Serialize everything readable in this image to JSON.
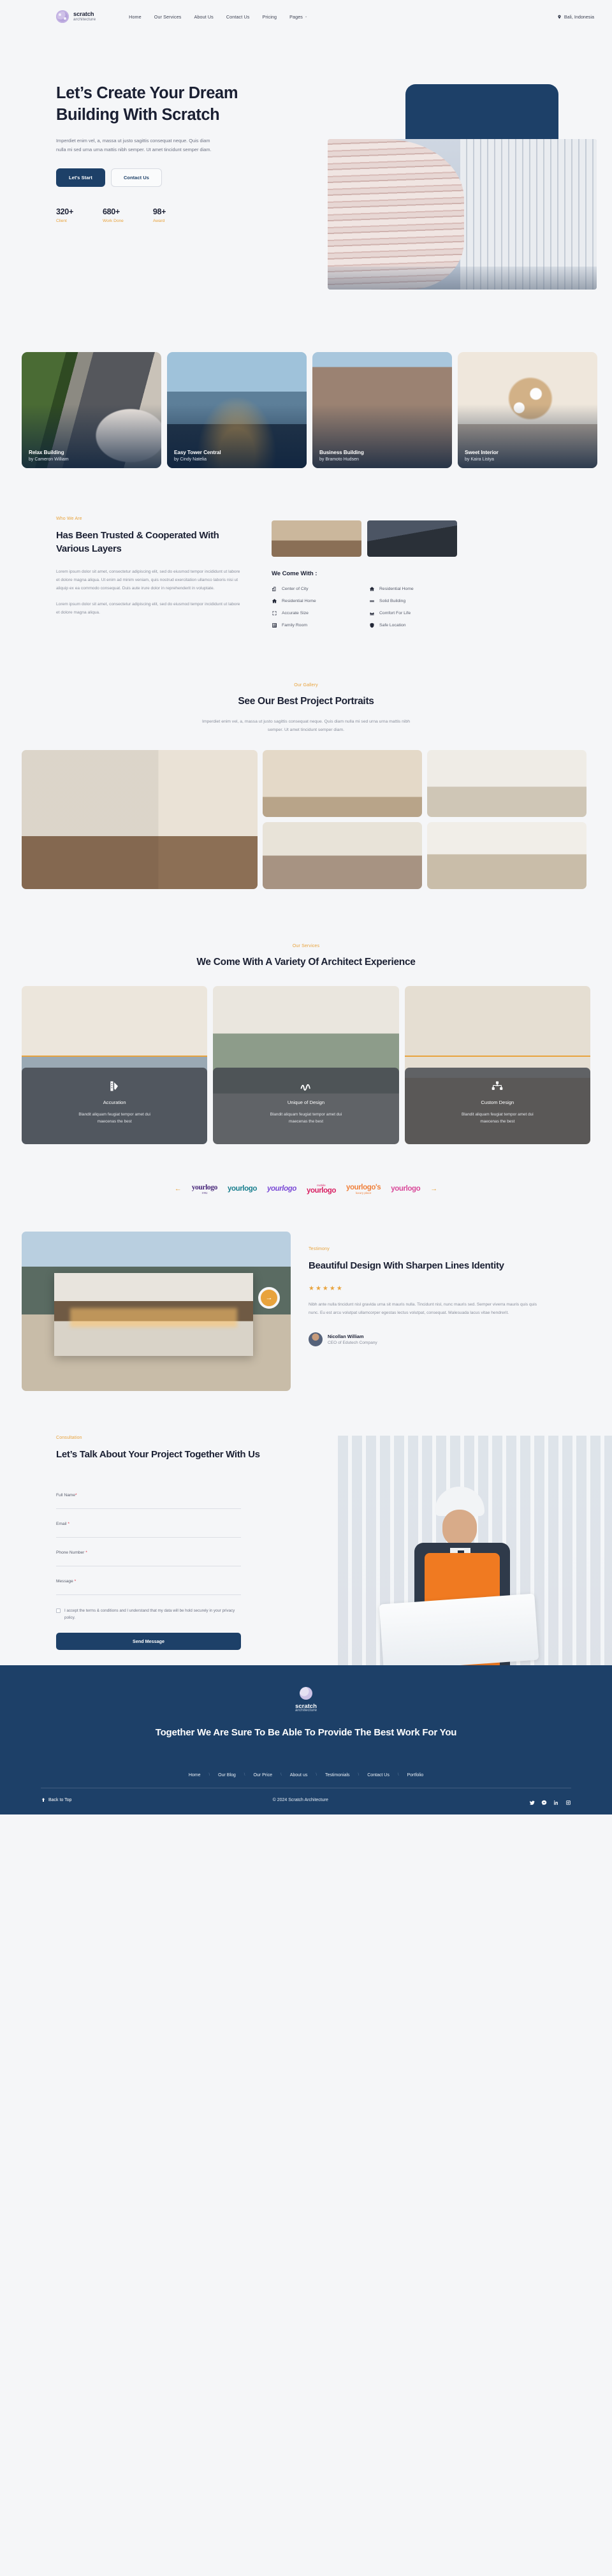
{
  "brand": {
    "name": "scratch",
    "sub": "architecture",
    "logo_icon": "flower-cluster-icon"
  },
  "header": {
    "nav": [
      {
        "label": "Home"
      },
      {
        "label": "Our Services"
      },
      {
        "label": "About Us"
      },
      {
        "label": "Contact Us"
      },
      {
        "label": "Pricing"
      },
      {
        "label": "Pages",
        "caret": "⌄"
      }
    ],
    "location": "Bali, Indonesia",
    "location_icon": "map-pin-icon"
  },
  "hero": {
    "title": "Let’s Create Your Dream Building With Scratch",
    "paragraph": "Imperdiet enim vel, a, massa ut justo sagittis consequat neque. Quis diam nulla mi sed urna urna mattis nibh semper. Ut amet tincidunt semper diam.",
    "primary_btn": "Let's Start",
    "secondary_btn": "Contact Us",
    "stats": [
      {
        "value": "320+",
        "label": "Client"
      },
      {
        "value": "680+",
        "label": "Work Done"
      },
      {
        "value": "98+",
        "label": "Award"
      }
    ]
  },
  "projects": [
    {
      "title": "Relax Building",
      "author": "by Cameron William"
    },
    {
      "title": "Easy Tower Central",
      "author": "by Cindy Natelia"
    },
    {
      "title": "Business Building",
      "author": "by Bramoto Hudsen"
    },
    {
      "title": "Sweet Interior",
      "author": "by Kaira Listya"
    }
  ],
  "who": {
    "eyebrow": "Who We Are",
    "title": "Has Been Trusted & Cooperated With Various Layers",
    "paragraph1": "Lorem ipsum dolor sit amet, consectetur adipiscing elit, sed do eiusmod tempor incididunt ut labore et dolore magna aliqua. Ut enim ad minim veniam, quis nostrud exercitation ullamco laboris nisi ut aliquip ex ea commodo consequat. Duis aute irure dolor in reprehenderit in voluptate.",
    "paragraph2": "Lorem ipsum dolor sit amet, consectetur adipiscing elit, sed do eiusmod tempor incididunt ut labore et dolore magna aliqua.",
    "features_title": "We Come With :",
    "features": [
      {
        "label": "Center of City",
        "icon": "city-buildings-icon"
      },
      {
        "label": "Residential Home",
        "icon": "home-icon"
      },
      {
        "label": "Residential Home",
        "icon": "home-icon"
      },
      {
        "label": "Solid Building",
        "icon": "layers-lines-icon"
      },
      {
        "label": "Accurate Size",
        "icon": "crop-frame-icon"
      },
      {
        "label": "Comfort For Life",
        "icon": "sofa-icon"
      },
      {
        "label": "Family Room",
        "icon": "grid-window-icon"
      },
      {
        "label": "Safe Location",
        "icon": "shield-icon"
      }
    ]
  },
  "gallery": {
    "eyebrow": "Our Gallery",
    "title": "See Our Best Project Portraits",
    "sub": "Imperdiet enim vel, a, massa ut justo sagittis consequat neque. Quis diam nulla mi sed urna urna mattis nibh semper. Ut amet tincidunt semper diam."
  },
  "services": {
    "eyebrow": "Our Services",
    "title": "We Come With A Variety Of Architect Experience",
    "cards": [
      {
        "title": "Accuration",
        "desc": "Blandit aliquam feugiat tempor amet dui maecenas the best",
        "icon": "color-swatch-icon"
      },
      {
        "title": "Unique of Design",
        "desc": "Blandit aliquam feugiat tempor amet dui maecenas the best",
        "icon": "signature-scribble-icon"
      },
      {
        "title": "Custom Design",
        "desc": "Blandit aliquam feugiat tempor amet dui maecenas the best",
        "icon": "nodes-connect-icon"
      }
    ]
  },
  "logos": {
    "prev_icon": "arrow-left-icon",
    "next_icon": "arrow-right-icon",
    "items": [
      {
        "text": "yourlogo",
        "sub": "1992"
      },
      {
        "text": "yourlogo",
        "sub": ""
      },
      {
        "text": "yourlogo",
        "sub": ""
      },
      {
        "text": "yourlogo",
        "sub": "mobile"
      },
      {
        "text": "yourlogo's",
        "sub": "luxury     place"
      },
      {
        "text": "yourlogo",
        "sub": ""
      }
    ]
  },
  "testimony": {
    "eyebrow": "Testimony",
    "title": "Beautiful Design With Sharpen Lines Identity",
    "stars": "★★★★★",
    "rating": 5,
    "quote": "Nibh ante nulla tincidunt nisl gravida urna sit mauris nulla. Tincidunt nisl, nunc mauris sed. Semper viverra mauris quis quis nunc. Eu est arcu volutpat ullamcorper egestas lectus volutpat, consequat. Malesuada lacus vitae hendrerit.",
    "person_name": "Nicollan William",
    "person_role": "CEO of Edutech Company",
    "next_icon": "arrow-right-circle-icon"
  },
  "consultation": {
    "eyebrow": "Consultation",
    "title": "Let’s Talk About Your Project Together With Us",
    "fields": [
      {
        "label": "Full Name",
        "required": "*",
        "value": "",
        "placeholder": ""
      },
      {
        "label": "Email",
        "required": "*",
        "value": "",
        "placeholder": ""
      },
      {
        "label": "Phone Number",
        "required": "*",
        "value": "",
        "placeholder": ""
      },
      {
        "label": "Message",
        "required": "*",
        "value": "",
        "placeholder": ""
      }
    ],
    "consent": "I accept the terms & conditions and I understand that my data will be hold securely in your privacy policy.",
    "submit": "Send Message"
  },
  "footer": {
    "headline": "Together We Are Sure To Be Able To Provide The Best Work For You",
    "nav": [
      {
        "label": "Home"
      },
      {
        "label": "Our Blog"
      },
      {
        "label": "Our Price"
      },
      {
        "label": "About us"
      },
      {
        "label": "Testimonials"
      },
      {
        "label": "Contact Us"
      },
      {
        "label": "Portfolio"
      }
    ],
    "back_to_top": "Back to Top",
    "back_to_top_icon": "arrow-up-icon",
    "copyright": "© 2024 Scratch Architecture",
    "socials": [
      {
        "icon": "twitter-icon"
      },
      {
        "icon": "messenger-icon"
      },
      {
        "icon": "linkedin-icon"
      },
      {
        "icon": "instagram-icon"
      }
    ]
  },
  "colors": {
    "navy": "#1d4068",
    "amber": "#e8a33d",
    "ink": "#1b2033",
    "bg": "#f5f6f8"
  }
}
